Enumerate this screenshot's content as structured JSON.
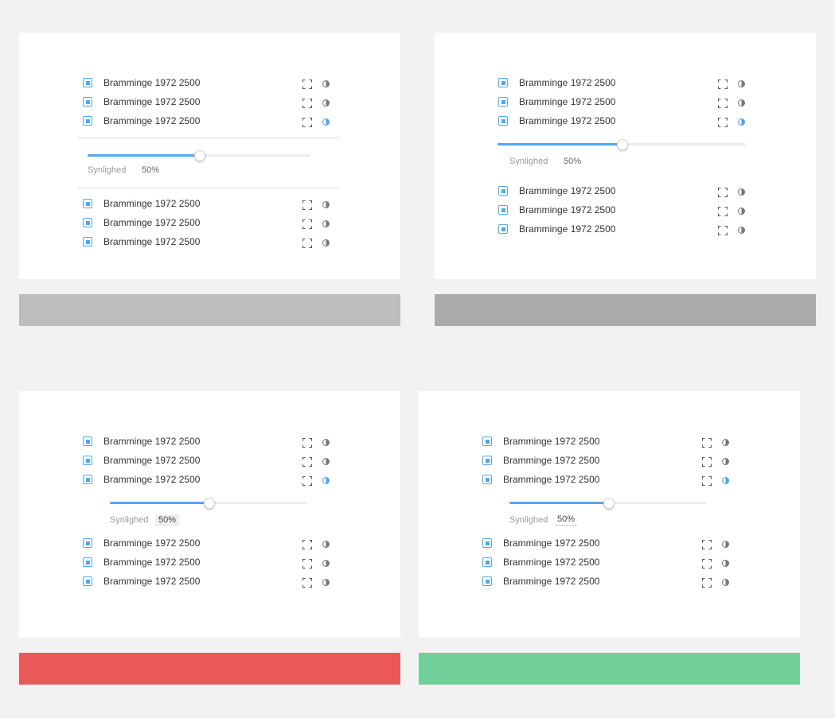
{
  "variants": [
    {
      "id": "variant-a",
      "layers": [
        {
          "label": "Bramminge 1972 2500",
          "fullscreen_icon": "fullscreen-icon",
          "contrast_icon": "contrast-icon",
          "contrast_active": false
        },
        {
          "label": "Bramminge 1972 2500",
          "fullscreen_icon": "fullscreen-icon",
          "contrast_icon": "contrast-icon",
          "contrast_active": false
        },
        {
          "label": "Bramminge 1972 2500",
          "fullscreen_icon": "fullscreen-icon",
          "contrast_icon": "contrast-icon",
          "contrast_active": true
        },
        {
          "label": "Bramminge 1972 2500",
          "fullscreen_icon": "fullscreen-icon",
          "contrast_icon": "contrast-icon",
          "contrast_active": false
        },
        {
          "label": "Bramminge 1972 2500",
          "fullscreen_icon": "fullscreen-icon",
          "contrast_icon": "contrast-icon",
          "contrast_active": false
        },
        {
          "label": "Bramminge 1972 2500",
          "fullscreen_icon": "fullscreen-icon",
          "contrast_icon": "contrast-icon",
          "contrast_active": false
        }
      ],
      "opacity": {
        "label": "Synlighed",
        "value_text": "50%",
        "value": 0.5
      },
      "bar_color": "#bdbdbd"
    },
    {
      "id": "variant-b",
      "layers": [
        {
          "label": "Bramminge 1972 2500",
          "fullscreen_icon": "fullscreen-icon",
          "contrast_icon": "contrast-icon",
          "contrast_active": false
        },
        {
          "label": "Bramminge 1972 2500",
          "fullscreen_icon": "fullscreen-icon",
          "contrast_icon": "contrast-icon",
          "contrast_active": false
        },
        {
          "label": "Bramminge 1972 2500",
          "fullscreen_icon": "fullscreen-icon",
          "contrast_icon": "contrast-icon",
          "contrast_active": true
        },
        {
          "label": "Bramminge 1972 2500",
          "fullscreen_icon": "fullscreen-icon",
          "contrast_icon": "contrast-icon",
          "contrast_active": false
        },
        {
          "label": "Bramminge 1972 2500",
          "fullscreen_icon": "fullscreen-icon",
          "contrast_icon": "contrast-icon",
          "contrast_active": false
        },
        {
          "label": "Bramminge 1972 2500",
          "fullscreen_icon": "fullscreen-icon",
          "contrast_icon": "contrast-icon",
          "contrast_active": false
        }
      ],
      "opacity": {
        "label": "Synlighed",
        "value_text": "50%",
        "value": 0.5
      },
      "bar_color": "#aaaaaa"
    },
    {
      "id": "variant-c",
      "layers": [
        {
          "label": "Bramminge 1972 2500",
          "fullscreen_icon": "fullscreen-icon",
          "contrast_icon": "contrast-icon",
          "contrast_active": false
        },
        {
          "label": "Bramminge 1972 2500",
          "fullscreen_icon": "fullscreen-icon",
          "contrast_icon": "contrast-icon",
          "contrast_active": false
        },
        {
          "label": "Bramminge 1972 2500",
          "fullscreen_icon": "fullscreen-icon",
          "contrast_icon": "contrast-icon",
          "contrast_active": true
        },
        {
          "label": "Bramminge 1972 2500",
          "fullscreen_icon": "fullscreen-icon",
          "contrast_icon": "contrast-icon",
          "contrast_active": false
        },
        {
          "label": "Bramminge 1972 2500",
          "fullscreen_icon": "fullscreen-icon",
          "contrast_icon": "contrast-icon",
          "contrast_active": false
        },
        {
          "label": "Bramminge 1972 2500",
          "fullscreen_icon": "fullscreen-icon",
          "contrast_icon": "contrast-icon",
          "contrast_active": false
        }
      ],
      "opacity": {
        "label": "Synlighed",
        "value_text": "50%",
        "value": 0.5
      },
      "bar_color": "#eb5858"
    },
    {
      "id": "variant-d",
      "layers": [
        {
          "label": "Bramminge 1972 2500",
          "fullscreen_icon": "fullscreen-icon",
          "contrast_icon": "contrast-icon",
          "contrast_active": false
        },
        {
          "label": "Bramminge 1972 2500",
          "fullscreen_icon": "fullscreen-icon",
          "contrast_icon": "contrast-icon",
          "contrast_active": false
        },
        {
          "label": "Bramminge 1972 2500",
          "fullscreen_icon": "fullscreen-icon",
          "contrast_icon": "contrast-icon",
          "contrast_active": true
        },
        {
          "label": "Bramminge 1972 2500",
          "fullscreen_icon": "fullscreen-icon",
          "contrast_icon": "contrast-icon",
          "contrast_active": false
        },
        {
          "label": "Bramminge 1972 2500",
          "fullscreen_icon": "fullscreen-icon",
          "contrast_icon": "contrast-icon",
          "contrast_active": false
        },
        {
          "label": "Bramminge 1972 2500",
          "fullscreen_icon": "fullscreen-icon",
          "contrast_icon": "contrast-icon",
          "contrast_active": false
        }
      ],
      "opacity": {
        "label": "Synlighed",
        "value_text": "50%",
        "value": 0.5
      },
      "bar_color": "#70cf96"
    }
  ],
  "colors": {
    "accent": "#52a7f2",
    "page_background": "#f2f2f2"
  }
}
